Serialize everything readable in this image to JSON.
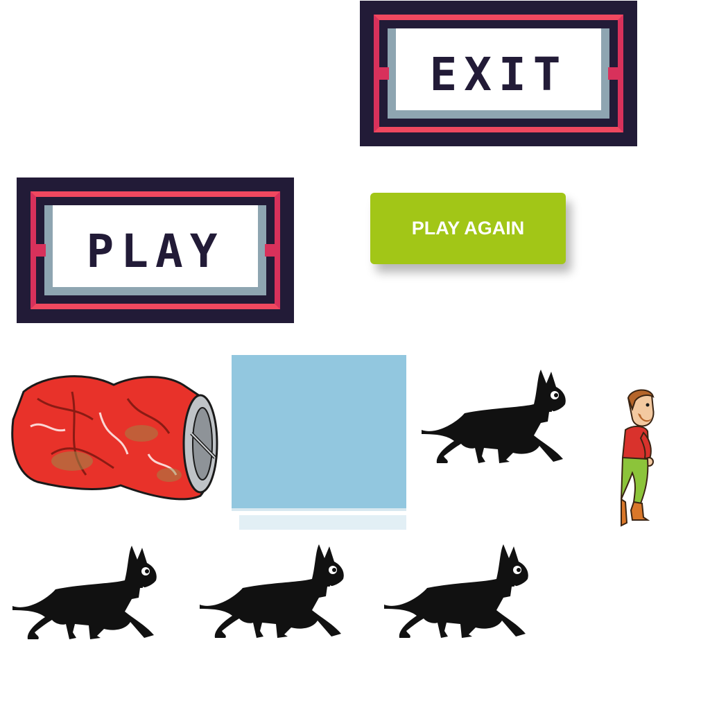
{
  "buttons": {
    "exit_label": "EXIT",
    "play_label": "PLAY",
    "play_again_label": "PLAY AGAIN"
  },
  "sprites": {
    "can": "crushed-can-icon",
    "water": "water-tile",
    "cat": "black-cat-icon",
    "man": "running-man-icon"
  },
  "colors": {
    "frame_dark": "#221b37",
    "frame_red": "#f0485f",
    "play_again_green": "#a2c617",
    "water_blue": "#92c7df"
  }
}
